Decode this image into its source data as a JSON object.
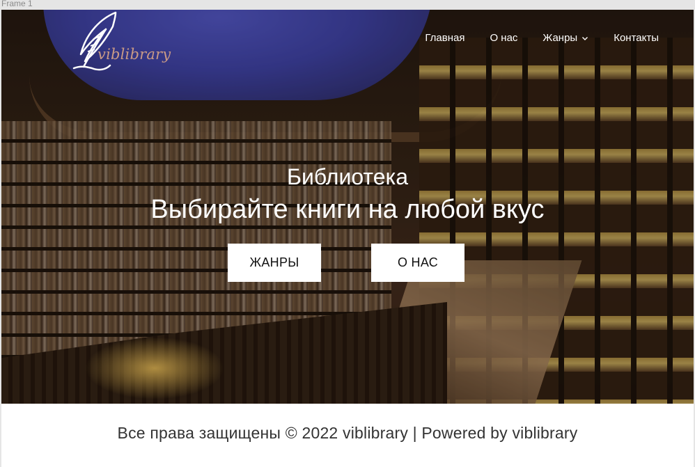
{
  "frame_label": "Frame 1",
  "logo": {
    "text": "viblibrary",
    "icon": "quill-feather-icon"
  },
  "nav": {
    "items": [
      {
        "label": "Главная"
      },
      {
        "label": "О нас"
      },
      {
        "label": "Жанры",
        "has_dropdown": true
      },
      {
        "label": "Контакты"
      }
    ]
  },
  "hero": {
    "title": "Библиотека",
    "subtitle": "Выбирайте книги на любой вкус",
    "buttons": {
      "genres": "ЖАНРЫ",
      "about": "О НАС"
    }
  },
  "footer": {
    "text": "Все права защищены © 2022 viblibrary | Powered by viblibrary"
  },
  "colors": {
    "logo_text": "#c99a86",
    "button_bg": "#ffffff",
    "nav_text": "#ffffff"
  }
}
